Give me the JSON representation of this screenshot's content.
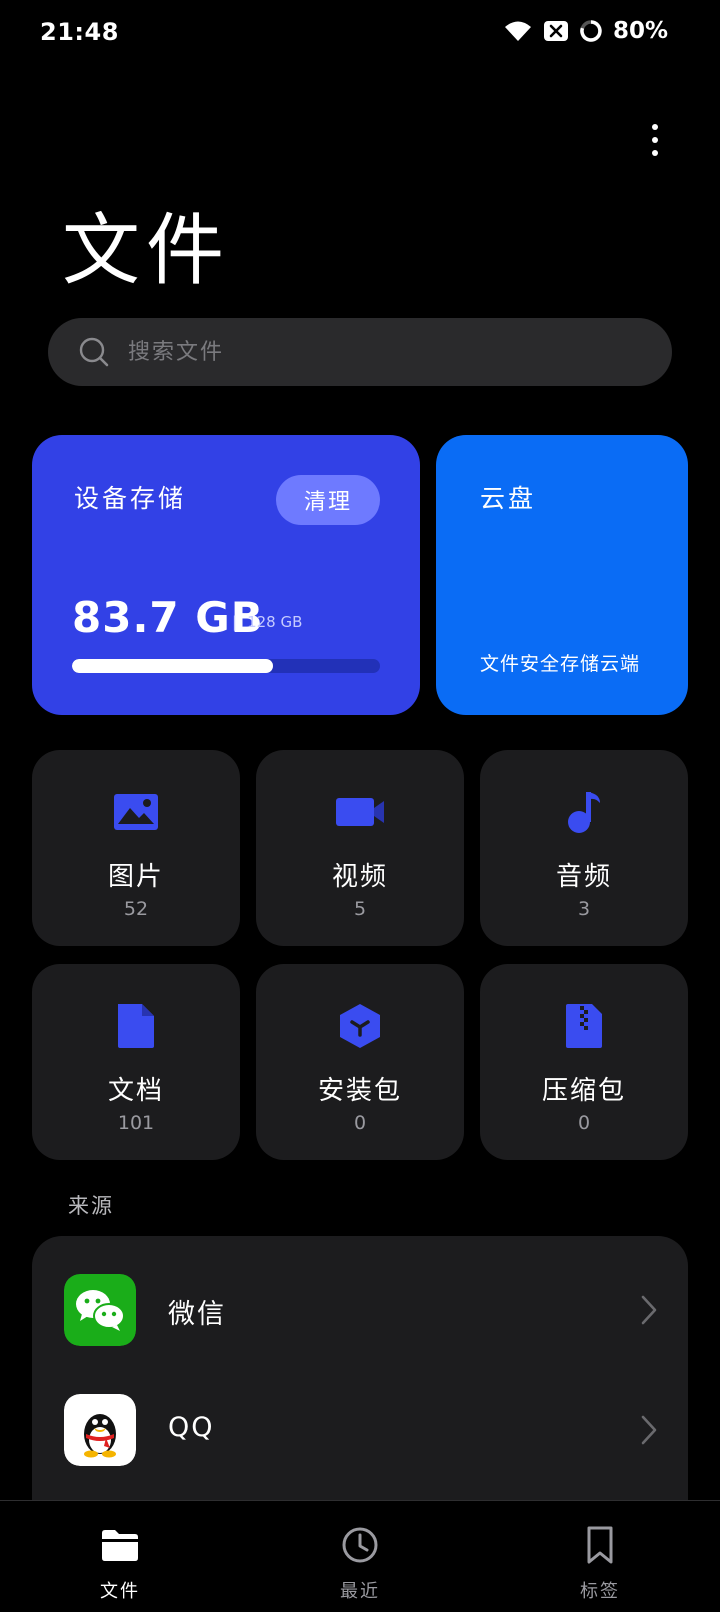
{
  "status_bar": {
    "time": "21:48",
    "battery": "80%"
  },
  "header": {
    "title": "文件"
  },
  "search": {
    "placeholder": "搜索文件"
  },
  "storage": {
    "title": "设备存储",
    "clean_label": "清理",
    "used": "83.7 GB",
    "separator": "|",
    "total": "128 GB",
    "used_fraction": 0.654
  },
  "cloud": {
    "title": "云盘",
    "description": "文件安全存储云端"
  },
  "categories": [
    {
      "label": "图片",
      "count": "52",
      "icon": "image-icon"
    },
    {
      "label": "视频",
      "count": "5",
      "icon": "video-icon"
    },
    {
      "label": "音频",
      "count": "3",
      "icon": "music-note-icon"
    },
    {
      "label": "文档",
      "count": "101",
      "icon": "document-icon"
    },
    {
      "label": "安装包",
      "count": "0",
      "icon": "package-icon"
    },
    {
      "label": "压缩包",
      "count": "0",
      "icon": "zip-icon"
    }
  ],
  "sources": {
    "title": "来源",
    "items": [
      {
        "name": "微信",
        "icon": "wechat-logo"
      },
      {
        "name": "QQ",
        "icon": "qq-logo"
      }
    ]
  },
  "nav": {
    "items": [
      {
        "label": "文件",
        "icon": "folder-icon",
        "active": true
      },
      {
        "label": "最近",
        "icon": "clock-icon",
        "active": false
      },
      {
        "label": "标签",
        "icon": "bookmark-icon",
        "active": false
      }
    ]
  },
  "colors": {
    "accent": "#3241e6",
    "cloud": "#0a6cf5",
    "icon_blue": "#3a4cf0",
    "tile_bg": "#1c1c1e",
    "wechat_green": "#1aad19"
  }
}
